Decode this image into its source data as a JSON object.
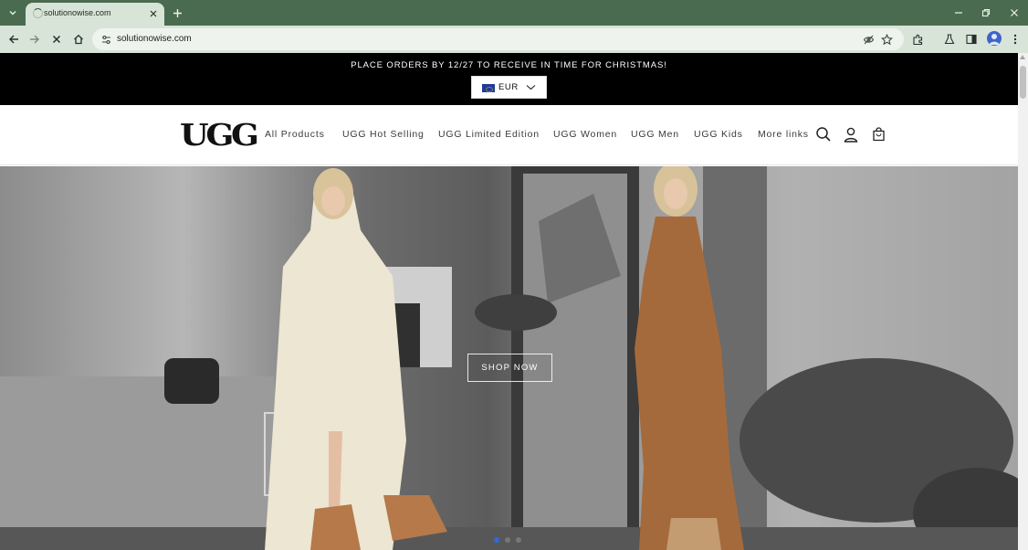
{
  "browser": {
    "tab": {
      "title": "solutionowise.com"
    },
    "address": {
      "url": "solutionowise.com"
    }
  },
  "announcement": {
    "text": "PLACE ORDERS BY 12/27 TO RECEIVE IN TIME FOR CHRISTMAS!",
    "currency": "EUR"
  },
  "header": {
    "logo": "UGG",
    "nav": [
      {
        "label": "All Products"
      },
      {
        "label": "UGG Hot Selling"
      },
      {
        "label": "UGG Limited Edition"
      },
      {
        "label": "UGG Women"
      },
      {
        "label": "UGG Men"
      },
      {
        "label": "UGG Kids"
      },
      {
        "label": "More links"
      }
    ]
  },
  "hero": {
    "cta": "SHOP NOW",
    "slides": 3,
    "active_slide": 1
  },
  "colors": {
    "browser_frame": "#4a6b4f",
    "toolbar": "#d8e4d8",
    "announcement_bg": "#000000",
    "active_dot": "#2f6bd6"
  }
}
